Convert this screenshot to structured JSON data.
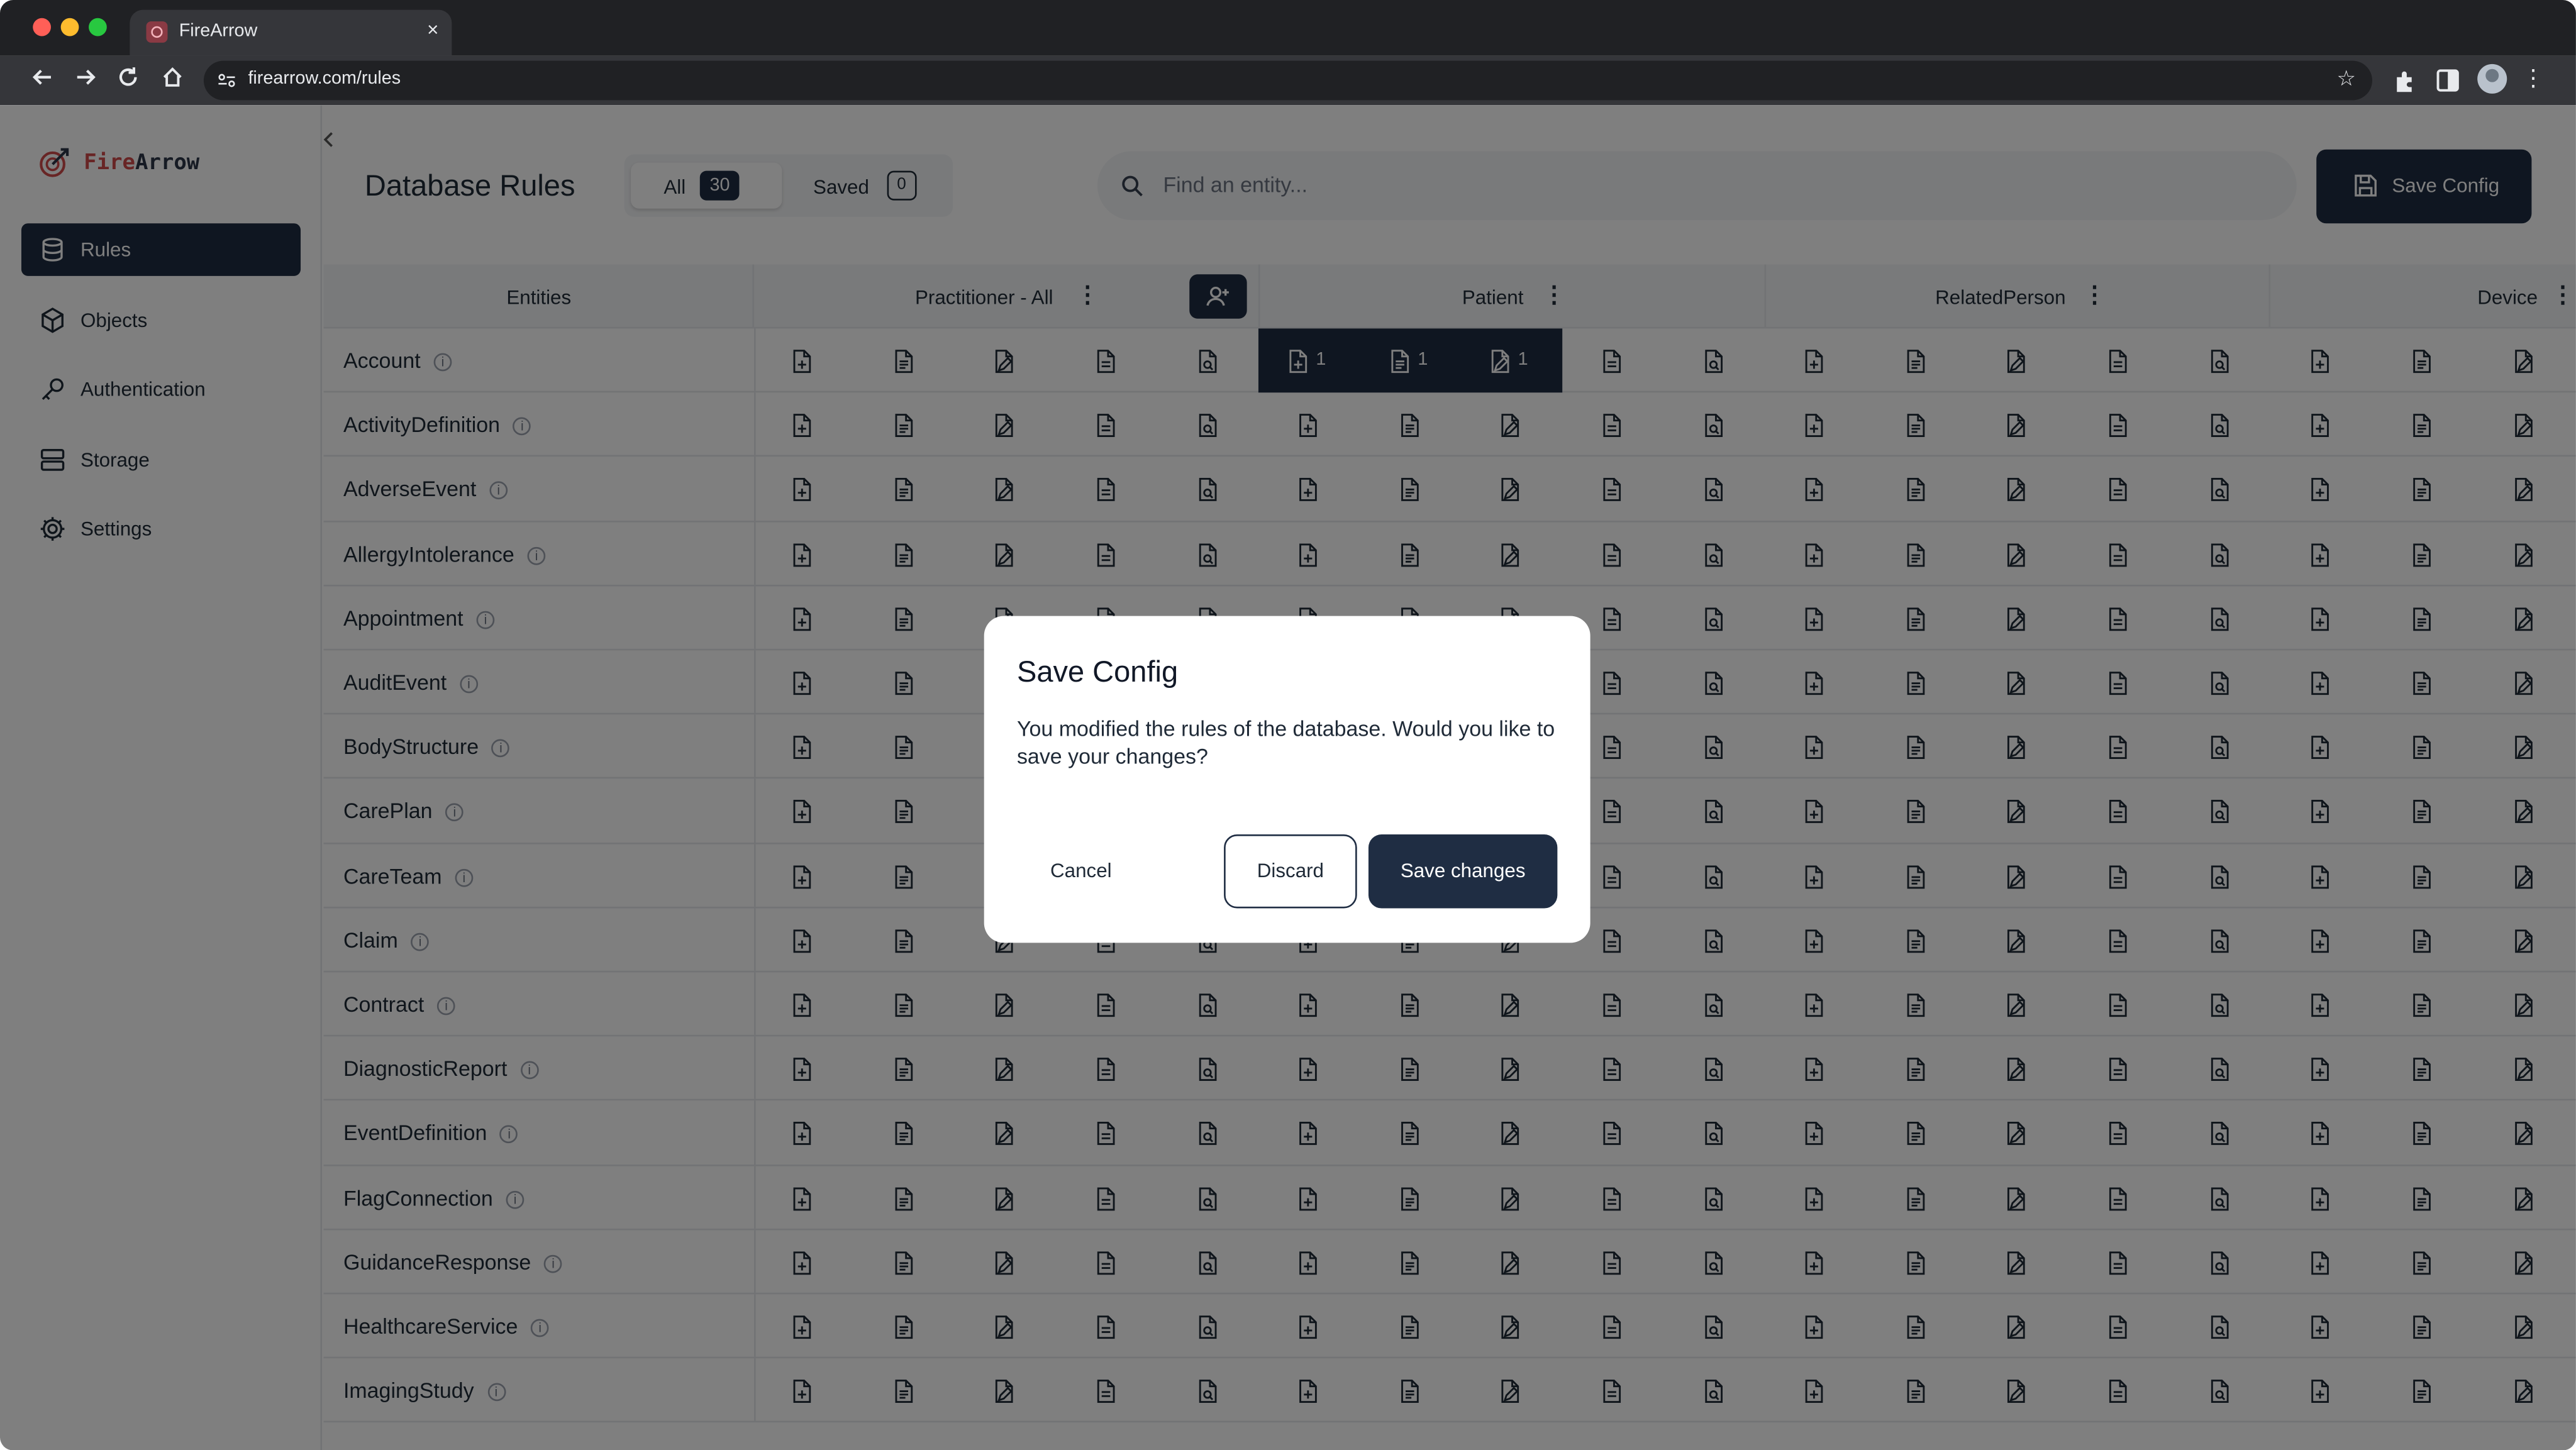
{
  "browser": {
    "tab_title": "FireArrow",
    "tab_close": "×",
    "url": "firearrow.com/rules"
  },
  "app": {
    "brand_fire": "Fire",
    "brand_arrow": "Arrow",
    "sidebar": {
      "items": [
        {
          "label": "Rules",
          "icon": "database-icon",
          "active": true
        },
        {
          "label": "Objects",
          "icon": "cube-icon",
          "active": false
        },
        {
          "label": "Authentication",
          "icon": "key-icon",
          "active": false
        },
        {
          "label": "Storage",
          "icon": "storage-icon",
          "active": false
        },
        {
          "label": "Settings",
          "icon": "gear-icon",
          "active": false
        }
      ]
    },
    "header": {
      "title": "Database Rules",
      "tabs": [
        {
          "label": "All",
          "count": "30"
        },
        {
          "label": "Saved",
          "count": "0"
        }
      ],
      "search_placeholder": "Find an entity...",
      "save_config_label": "Save Config"
    },
    "grid": {
      "entities_header": "Entities",
      "columns": [
        "Practitioner - All",
        "Patient",
        "RelatedPerson",
        "Device"
      ],
      "highlight": {
        "row": "Account",
        "column": "Patient",
        "counts": [
          "1",
          "1",
          "1"
        ]
      },
      "rows": [
        "Account",
        "ActivityDefinition",
        "AdverseEvent",
        "AllergyIntolerance",
        "Appointment",
        "AuditEvent",
        "BodyStructure",
        "CarePlan",
        "CareTeam",
        "Claim",
        "Contract",
        "DiagnosticReport",
        "EventDefinition",
        "FlagConnection",
        "GuidanceResponse",
        "HealthcareService",
        "ImagingStudy"
      ]
    },
    "colors": {
      "primary": "#1f2d43",
      "brand_red": "#d14b4b"
    }
  },
  "dialog": {
    "title": "Save Config",
    "body": "You modified the rules of the database. Would you like to save your changes?",
    "cancel_label": "Cancel",
    "discard_label": "Discard",
    "save_label": "Save changes"
  }
}
